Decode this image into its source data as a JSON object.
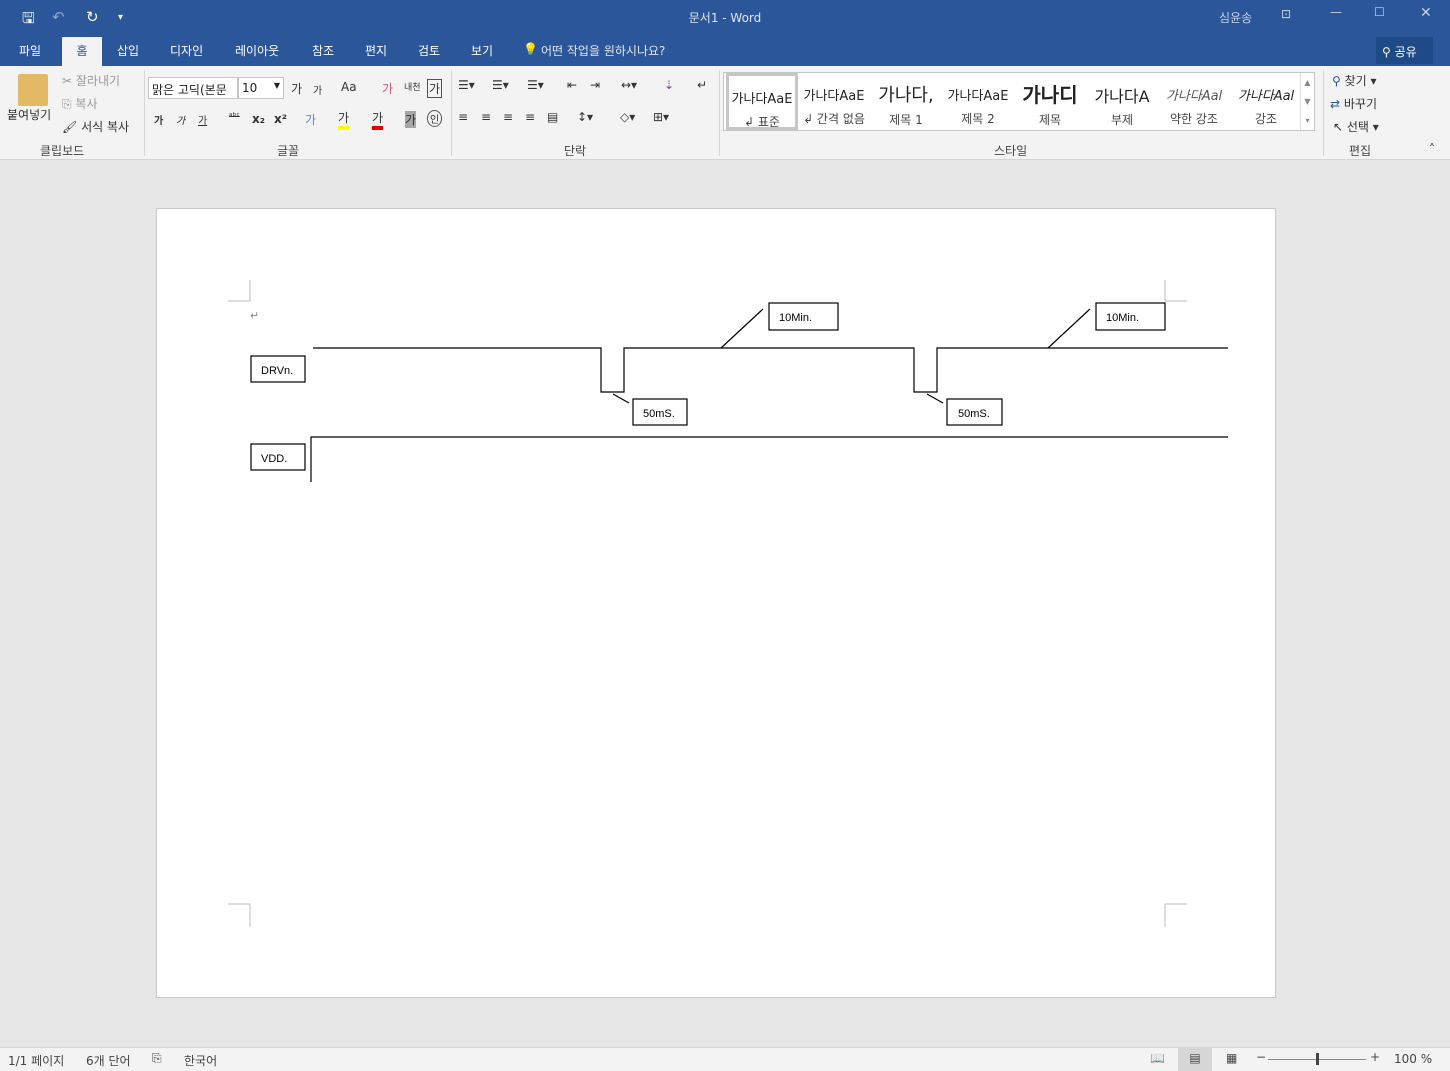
{
  "window": {
    "title": "문서1 - Word",
    "user": "심윤송"
  },
  "quick_access": {
    "save_icon": "save-icon",
    "undo_icon": "undo-icon",
    "redo_icon": "redo-icon",
    "customize_icon": "dropdown-icon"
  },
  "tabs": [
    {
      "label": "파일"
    },
    {
      "label": "홈"
    },
    {
      "label": "삽입"
    },
    {
      "label": "디자인"
    },
    {
      "label": "레이아웃"
    },
    {
      "label": "참조"
    },
    {
      "label": "편지"
    },
    {
      "label": "검토"
    },
    {
      "label": "보기"
    }
  ],
  "tell_me": "어떤 작업을 원하시나요?",
  "share": "공유",
  "clipboard": {
    "paste": "붙여넣기",
    "cut": "잘라내기",
    "copy": "복사",
    "format_painter": "서식 복사",
    "label": "클립보드"
  },
  "font": {
    "name": "맑은 고딕(본문",
    "size": "10",
    "label": "글꼴",
    "grow": "가",
    "shrink": "가",
    "case": "Aa",
    "bold": "가",
    "italic": "가",
    "underline": "가",
    "strike": "ᵃᵇᶜ",
    "sub": "x₂",
    "sup": "x²",
    "highlight": "가",
    "color": "가",
    "shade": "가",
    "enclose": "인",
    "phonetic": "내천",
    "border": "가",
    "clear": "가"
  },
  "paragraph": {
    "label": "단락"
  },
  "styles": {
    "label": "스타일",
    "items": [
      {
        "preview": "가나다AaE",
        "name": "↲ 표준"
      },
      {
        "preview": "가나다AaE",
        "name": "↲ 간격 없음"
      },
      {
        "preview": "가나다,",
        "name": "제목 1"
      },
      {
        "preview": "가나다AaE",
        "name": "제목 2"
      },
      {
        "preview": "가나디",
        "name": "제목"
      },
      {
        "preview": "가나다A",
        "name": "부제"
      },
      {
        "preview": "가나다Aal",
        "name": "약한 강조"
      },
      {
        "preview": "가나다Aal",
        "name": "강조"
      }
    ]
  },
  "editing": {
    "find": "찾기",
    "replace": "바꾸기",
    "select": "선택",
    "label": "편집"
  },
  "document": {
    "paragraph_mark": "↵",
    "diagram": {
      "drv_label": "DRVn.",
      "vdd_label": "VDD.",
      "min_label_1": "10Min.",
      "min_label_2": "10Min.",
      "ms_label_1": "50mS.",
      "ms_label_2": "50mS."
    }
  },
  "status": {
    "page": "1/1 페이지",
    "words": "6개 단어",
    "language": "한국어",
    "zoom": "100 %",
    "zoom_level": 100
  }
}
